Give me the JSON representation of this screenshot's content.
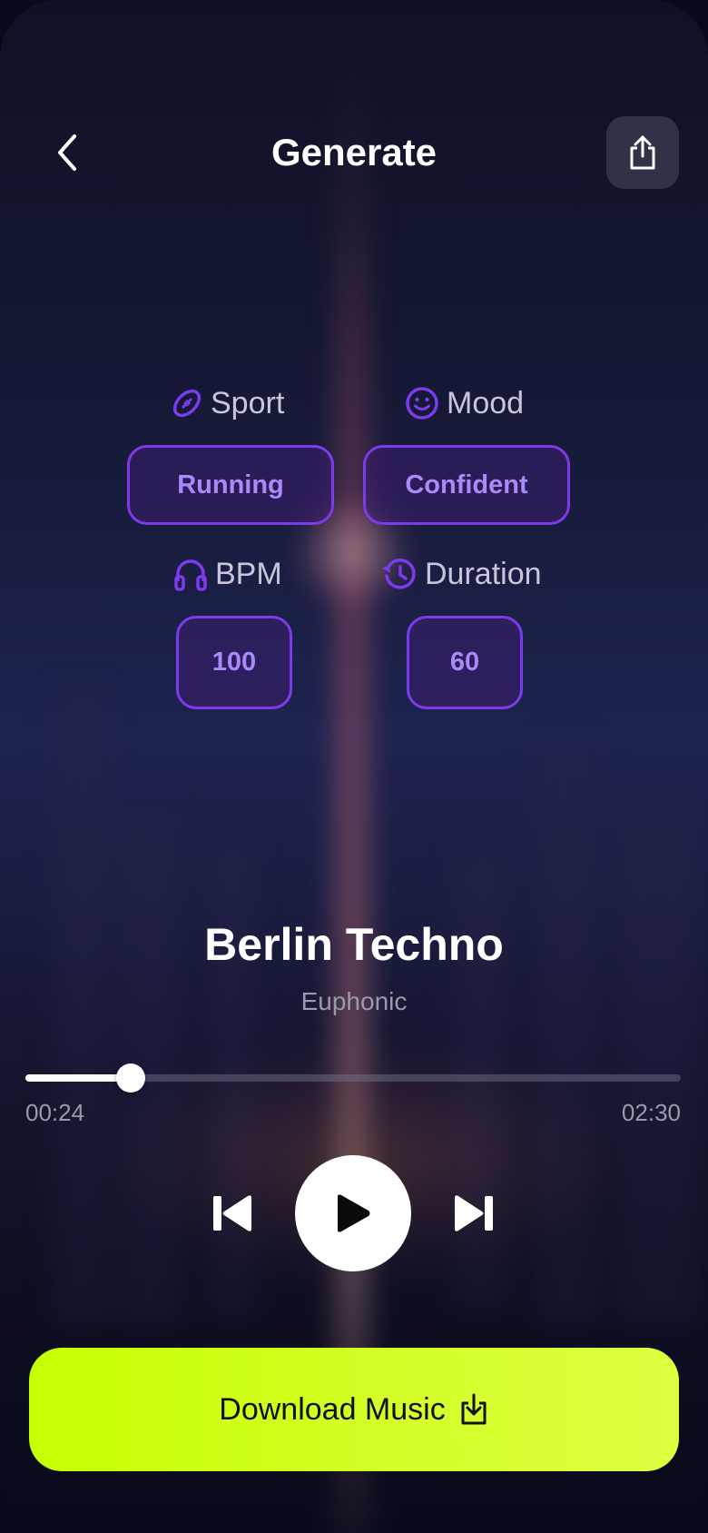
{
  "header": {
    "title": "Generate",
    "back_icon": "chevron-left-icon",
    "share_icon": "share-icon"
  },
  "params": {
    "sport": {
      "label": "Sport",
      "icon": "football-icon",
      "value": "Running"
    },
    "mood": {
      "label": "Mood",
      "icon": "smiley-icon",
      "value": "Confident"
    },
    "bpm": {
      "label": "BPM",
      "icon": "headphones-icon",
      "value": "100"
    },
    "duration": {
      "label": "Duration",
      "icon": "history-clock-icon",
      "value": "60"
    }
  },
  "track": {
    "title": "Berlin Techno",
    "artist": "Euphonic",
    "elapsed": "00:24",
    "total": "02:30",
    "progress": 0.16
  },
  "controls": {
    "previous_icon": "skip-previous-icon",
    "play_icon": "play-icon",
    "next_icon": "skip-next-icon"
  },
  "download": {
    "label": "Download Music",
    "icon": "download-icon"
  },
  "colors": {
    "accent_purple": "#7c3aed",
    "chip_text": "#a78bfa",
    "download_bg": "#c8ff00"
  }
}
